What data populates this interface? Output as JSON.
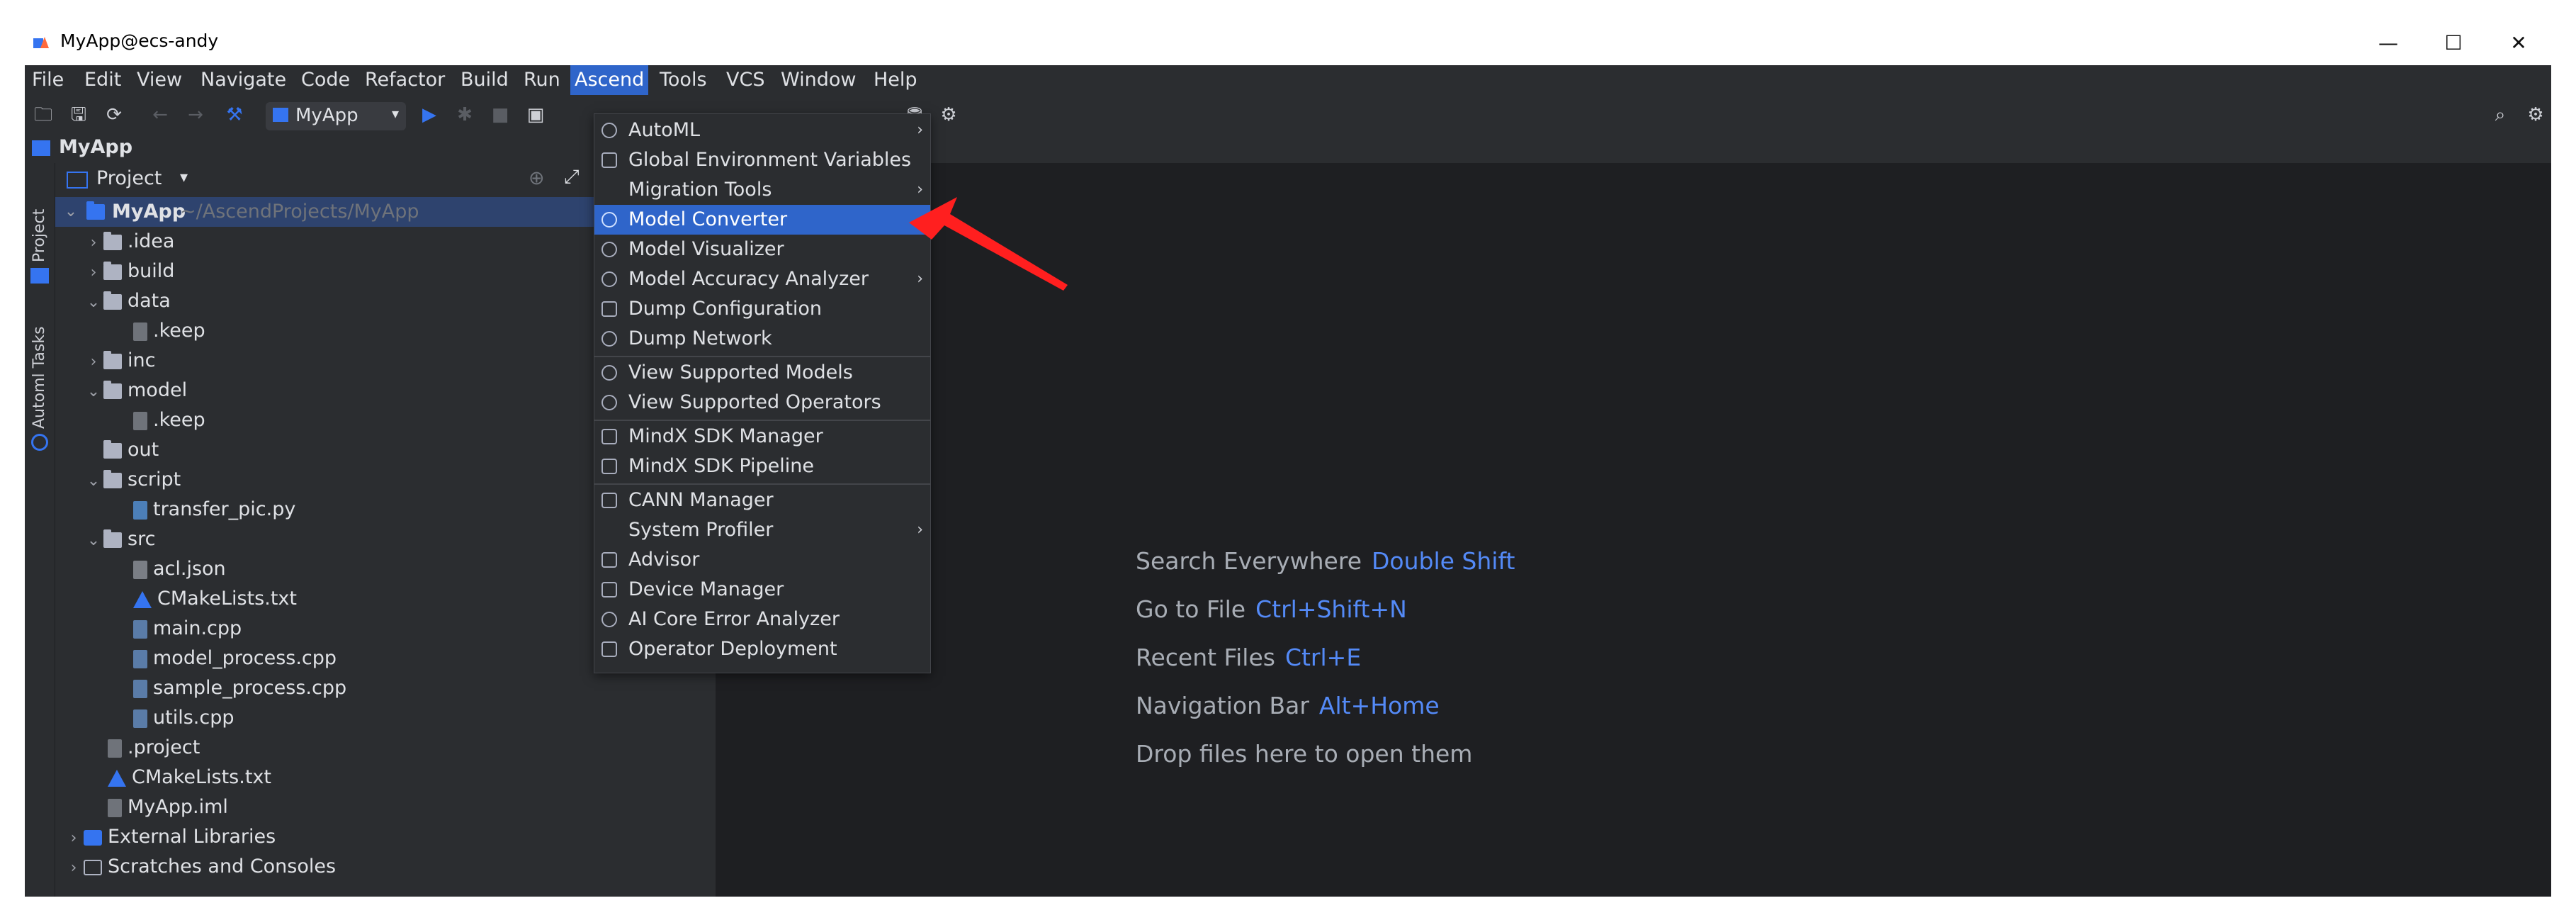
{
  "window": {
    "title": "MyApp@ecs-andy",
    "controls": {
      "minimize": "—",
      "maximize": "☐",
      "close": "✕"
    }
  },
  "menubar": {
    "items": [
      "File",
      "Edit",
      "View",
      "Navigate",
      "Code",
      "Refactor",
      "Build",
      "Run",
      "Ascend",
      "Tools",
      "VCS",
      "Window",
      "Help"
    ],
    "active": "Ascend"
  },
  "toolbar": {
    "run_config": "MyApp"
  },
  "navbar": {
    "project_name": "MyApp"
  },
  "side_tabs": {
    "project": "Project",
    "tasks": "Automl Tasks"
  },
  "project_panel": {
    "title": "Project",
    "root": {
      "name": "MyApp",
      "path": "~/AscendProjects/MyApp"
    },
    "tree": [
      ".idea",
      "build",
      "data",
      ".keep",
      "inc",
      "model",
      ".keep",
      "out",
      "script",
      "transfer_pic.py",
      "src",
      "acl.json",
      "CMakeLists.txt",
      "main.cpp",
      "model_process.cpp",
      "sample_process.cpp",
      "utils.cpp",
      ".project",
      "CMakeLists.txt",
      "MyApp.iml",
      "External Libraries",
      "Scratches and Consoles"
    ]
  },
  "ascend_menu": {
    "items": [
      "AutoML",
      "Global Environment Variables",
      "Migration Tools",
      "Model Converter",
      "Model Visualizer",
      "Model Accuracy Analyzer",
      "Dump Configuration",
      "Dump Network",
      "View Supported Models",
      "View Supported Operators",
      "MindX SDK Manager",
      "MindX SDK Pipeline",
      "CANN Manager",
      "System Profiler",
      "Advisor",
      "Device Manager",
      "AI Core Error Analyzer",
      "Operator Deployment"
    ],
    "highlighted": "Model Converter"
  },
  "editor_hints": [
    {
      "label": "Search Everywhere",
      "key": "Double Shift"
    },
    {
      "label": "Go to File",
      "key": "Ctrl+Shift+N"
    },
    {
      "label": "Recent Files",
      "key": "Ctrl+E"
    },
    {
      "label": "Navigation Bar",
      "key": "Alt+Home"
    },
    {
      "label": "Drop files here to open them",
      "key": ""
    }
  ],
  "colors": {
    "accent": "#2f65ca",
    "hint_key": "#548af7",
    "annotation_arrow": "#ff1f1f"
  }
}
